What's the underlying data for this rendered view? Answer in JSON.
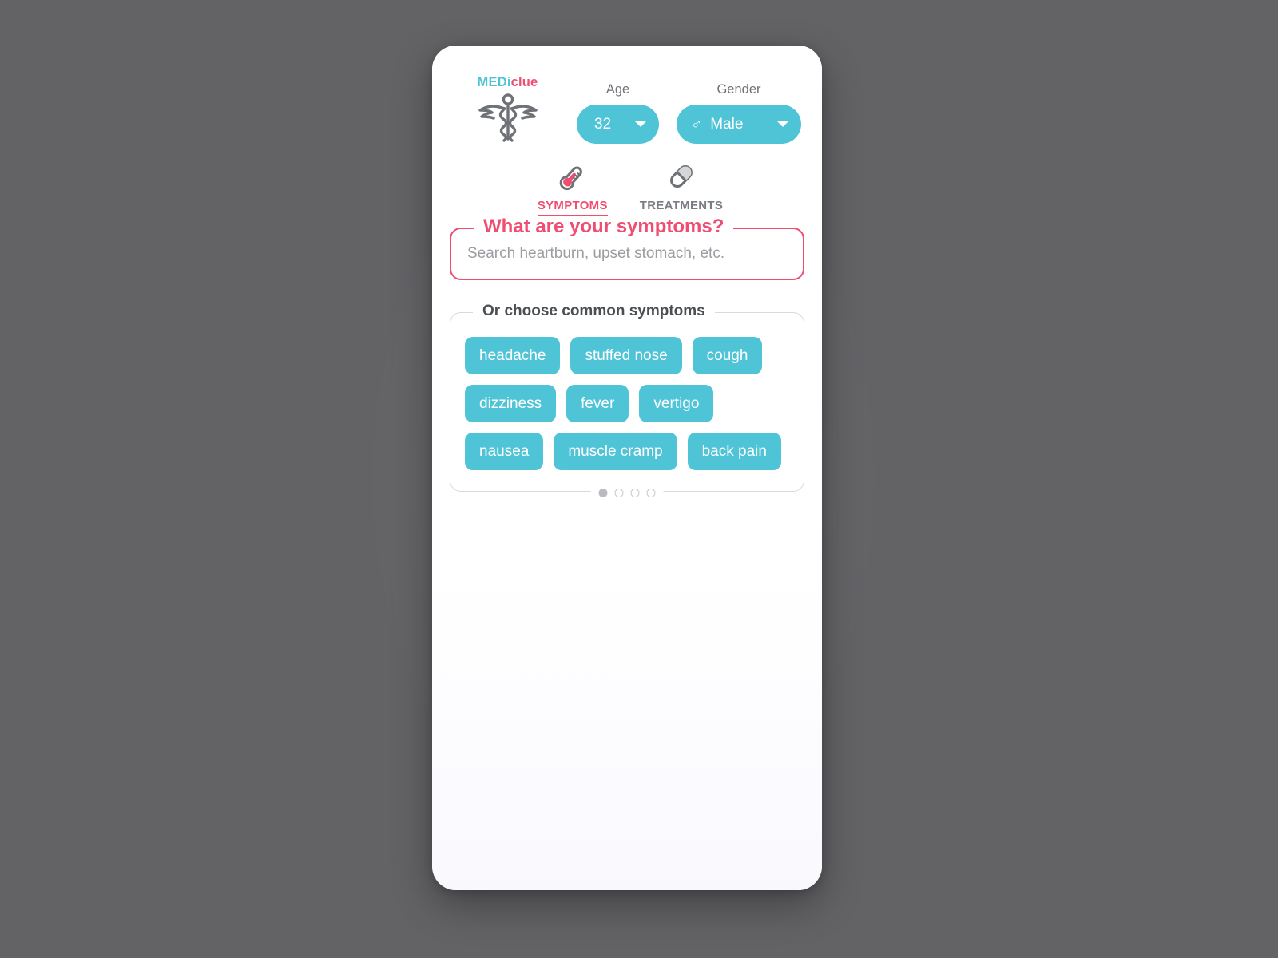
{
  "app": {
    "brand_primary": "MEDi",
    "brand_secondary": "clue",
    "logo_icon": "caduceus-icon"
  },
  "colors": {
    "teal": "#4FC4D6",
    "pink": "#EF4E72",
    "gray_text": "#6e7175",
    "background": "#636366"
  },
  "header": {
    "age": {
      "label": "Age",
      "value": "32",
      "caret_icon": "chevron-down-icon"
    },
    "gender": {
      "label": "Gender",
      "value": "Male",
      "symbol": "♂",
      "symbol_icon": "mars-symbol-icon",
      "caret_icon": "chevron-down-icon"
    }
  },
  "tabs": [
    {
      "label": "SYMPTOMS",
      "icon": "thermometer-icon",
      "active": true
    },
    {
      "label": "TREATMENTS",
      "icon": "pill-capsule-icon",
      "active": false
    }
  ],
  "search": {
    "legend": "What are your symptoms?",
    "placeholder": "Search heartburn, upset stomach, etc.",
    "value": ""
  },
  "common": {
    "legend": "Or choose common symptoms",
    "rows": [
      [
        "headache",
        "stuffed nose",
        "cough"
      ],
      [
        "dizziness",
        "fever",
        "vertigo"
      ],
      [
        "nausea",
        "muscle cramp",
        "back pain"
      ]
    ],
    "pagination": {
      "total": 4,
      "active_index": 0
    }
  }
}
